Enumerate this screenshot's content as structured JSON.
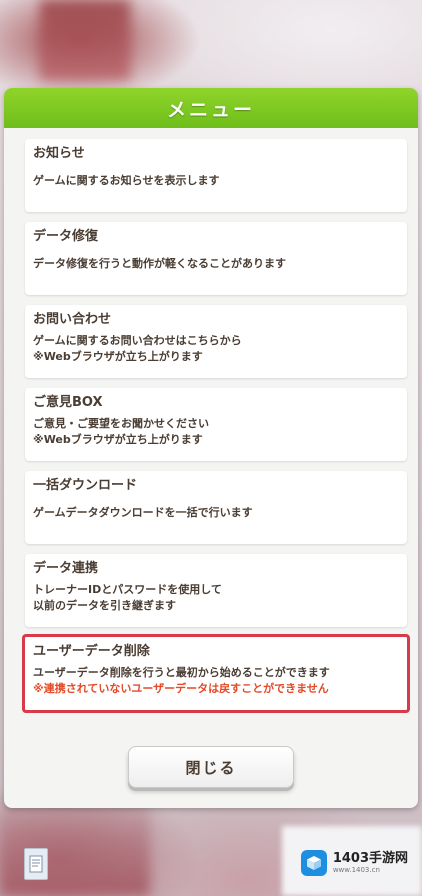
{
  "dialog": {
    "title": "メニュー",
    "close_label": "閉じる"
  },
  "menu_items": [
    {
      "title": "お知らせ",
      "desc": [
        "ゲームに関するお知らせを表示します"
      ]
    },
    {
      "title": "データ修復",
      "desc": [
        "データ修復を行うと動作が軽くなることがあります"
      ]
    },
    {
      "title": "お問い合わせ",
      "desc": [
        "ゲームに関するお問い合わせはこちらから",
        "※Webブラウザが立ち上がります"
      ]
    },
    {
      "title": "ご意見BOX",
      "desc": [
        "ご意見・ご要望をお聞かせください",
        "※Webブラウザが立ち上がります"
      ]
    },
    {
      "title": "一括ダウンロード",
      "desc": [
        "ゲームデータダウンロードを一括で行います"
      ]
    },
    {
      "title": "データ連携",
      "desc": [
        "トレーナーIDとパスワードを使用して",
        "以前のデータを引き継ぎます"
      ]
    },
    {
      "title": "ユーザーデータ削除",
      "desc": [
        "ユーザーデータ削除を行うと最初から始めることができます"
      ],
      "warning": "※連携されていないユーザーデータは戻すことができません"
    }
  ],
  "watermark": {
    "main": "1403手游网",
    "sub": "www.1403.cn"
  },
  "colors": {
    "header_green": "#7cc922",
    "text_brown": "#4a3d33",
    "warning_red": "#e34a27",
    "highlight_red": "#d83a4a"
  },
  "icons": {
    "corner": "document-icon",
    "watermark": "cube-logo-icon"
  }
}
